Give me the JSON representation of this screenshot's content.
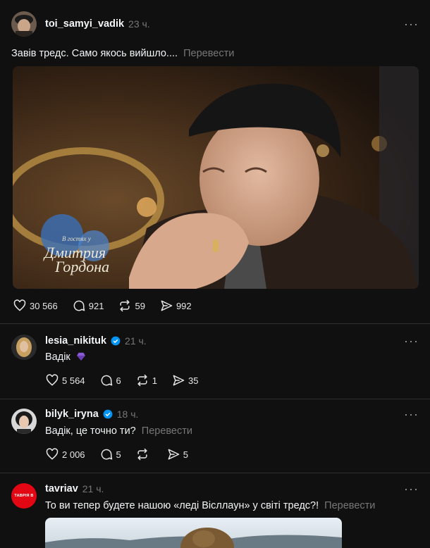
{
  "posts": [
    {
      "username": "toi_samyi_vadik",
      "time": "23 ч.",
      "text": "Завів тредс. Само якось вийшло....",
      "translate": "Перевести",
      "more": "···",
      "likes": "30 566",
      "replies": "921",
      "reposts": "59",
      "shares": "992",
      "media_caption_small": "В гостях у",
      "media_caption_line1": "Дмитрия",
      "media_caption_line2": "Гордона"
    },
    {
      "username": "lesia_nikituk",
      "time": "21 ч.",
      "text": "Вадік",
      "more": "···",
      "likes": "5 564",
      "replies": "6",
      "reposts": "1",
      "shares": "35"
    },
    {
      "username": "bilyk_iryna",
      "time": "18 ч.",
      "text": "Вадік, це точно ти?",
      "translate": "Перевести",
      "more": "···",
      "likes": "2 006",
      "replies": "5",
      "reposts": "",
      "shares": "5"
    },
    {
      "username": "tavriav",
      "time": "21 ч.",
      "text": "То ви тепер будете нашою «леді Вісллаун» у світі тредс?!",
      "translate": "Перевести",
      "more": "···",
      "avatar_text": "ТАВРІЯ В"
    }
  ],
  "colors": {
    "background": "#101010",
    "muted": "#777777",
    "verified": "#0095f6",
    "tavria_red": "#e30613"
  }
}
